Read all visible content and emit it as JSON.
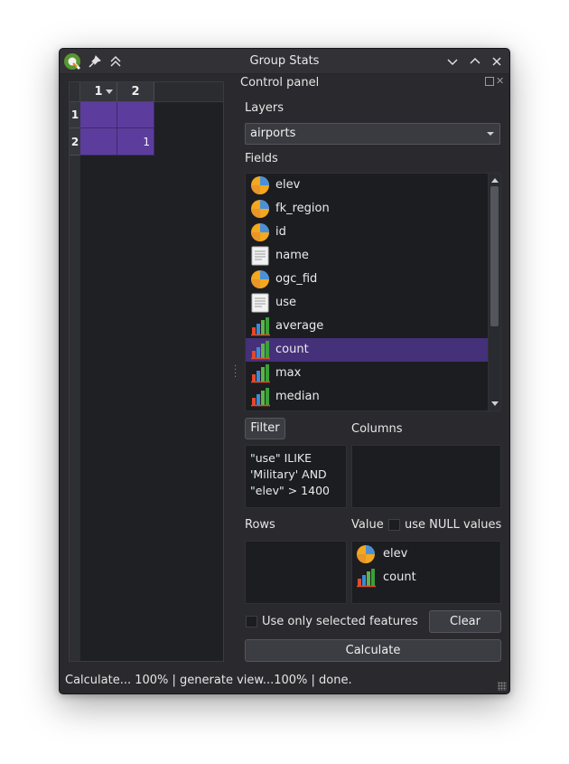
{
  "window": {
    "title": "Group Stats"
  },
  "table": {
    "col_headers": [
      "1",
      "2"
    ],
    "row_headers": [
      "1",
      "2"
    ],
    "cells": [
      [
        "",
        ""
      ],
      [
        "",
        "1"
      ]
    ]
  },
  "control_panel": {
    "title": "Control panel",
    "layers_label": "Layers",
    "layer_selected": "airports",
    "fields_label": "Fields",
    "fields": [
      {
        "name": "elev",
        "icon": "numeric-field-icon"
      },
      {
        "name": "fk_region",
        "icon": "numeric-field-icon"
      },
      {
        "name": "id",
        "icon": "numeric-field-icon"
      },
      {
        "name": "name",
        "icon": "text-field-icon"
      },
      {
        "name": "ogc_fid",
        "icon": "numeric-field-icon"
      },
      {
        "name": "use",
        "icon": "text-field-icon"
      },
      {
        "name": "average",
        "icon": "statistic-bar-chart-icon"
      },
      {
        "name": "count",
        "icon": "statistic-bar-chart-icon",
        "selected": true
      },
      {
        "name": "max",
        "icon": "statistic-bar-chart-icon"
      },
      {
        "name": "median",
        "icon": "statistic-bar-chart-icon"
      }
    ],
    "filter_button": "Filter",
    "filter_expression": "\"use\" ILIKE 'Military' AND \"elev\" > 1400",
    "columns_label": "Columns",
    "rows_label": "Rows",
    "value_label": "Value",
    "null_values_label": "use NULL values",
    "value_items": [
      {
        "name": "elev",
        "icon": "numeric-field-icon"
      },
      {
        "name": "count",
        "icon": "statistic-bar-chart-icon"
      }
    ],
    "selected_features_label": "Use only selected features",
    "clear_button": "Clear",
    "calculate_button": "Calculate"
  },
  "status": {
    "text": "Calculate... 100% |  generate view...100% |  done."
  },
  "colors": {
    "selection": "#45307a",
    "cell_highlight": "#5c3d9e",
    "background": "#2a2a2e"
  }
}
